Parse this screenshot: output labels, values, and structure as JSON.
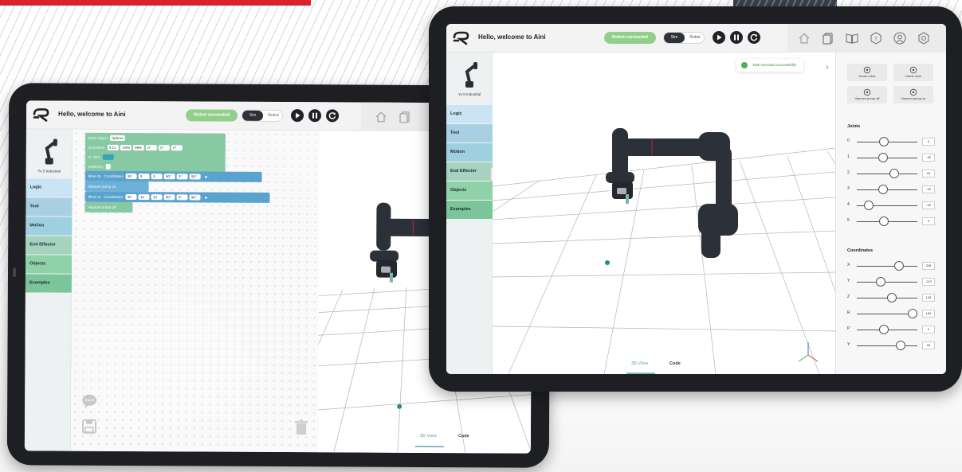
{
  "app": {
    "welcome": "Hello, welcome to Aini",
    "connect_label": "Robot connected",
    "mode_sim": "Sim",
    "mode_robot": "Robot",
    "robot_name": "Yu 5 Industrial",
    "accent_green": "#92cf8a",
    "accent_blue": "#5aa3cf"
  },
  "playback_icons": [
    "play-icon",
    "pause-icon",
    "reset-icon"
  ],
  "nav_icons": [
    "home-icon",
    "files-icon",
    "book-icon",
    "help-icon",
    "user-icon",
    "settings-icon"
  ],
  "categories": [
    {
      "label": "Logic",
      "color": "#c9e4f2"
    },
    {
      "label": "Tool",
      "color": "#a9cfe3"
    },
    {
      "label": "Motion",
      "color": "#9fd0df"
    },
    {
      "label": "End Effector",
      "color": "#a6d3c0"
    },
    {
      "label": "Objects",
      "color": "#8fd2a9"
    },
    {
      "label": "Examples",
      "color": "#7cc59a"
    }
  ],
  "blocks": {
    "place_object": "place object",
    "object_type": "Sphere",
    "at_position": "at position",
    "in_color": "in color",
    "scaled_by": "scaled by",
    "move_to": "Move to",
    "coordinates": "Coordinates",
    "pump_on": "Vacuum pump on",
    "pump_off": "Vacuum pump off",
    "pos_values": [
      "0.1x",
      "-10%",
      "99%",
      "0°",
      "0°",
      "0°"
    ],
    "coords_a": [
      "30",
      "5",
      "3",
      "90°",
      "0°",
      "90°"
    ],
    "coords_b": [
      "30",
      "12",
      "13",
      "90°",
      "0°",
      "90°"
    ]
  },
  "view_tabs": {
    "view3d": "3D View",
    "code": "Code"
  },
  "toast": "Task executed successfully!",
  "control_buttons": [
    "Home robot",
    "Home view",
    "Vacuum pump off",
    "Vacuum pump on"
  ],
  "joints": {
    "title": "Joints",
    "items": [
      {
        "label": "0",
        "value": "0",
        "fraction": 0.45
      },
      {
        "label": "1",
        "value": "-30",
        "fraction": 0.44
      },
      {
        "label": "2",
        "value": "90",
        "fraction": 0.62
      },
      {
        "label": "3",
        "value": "-30",
        "fraction": 0.44
      },
      {
        "label": "4",
        "value": "-90",
        "fraction": 0.2
      },
      {
        "label": "5",
        "value": "0",
        "fraction": 0.45
      }
    ]
  },
  "coordinates": {
    "title": "Coordinates",
    "items": [
      {
        "label": "X",
        "value": "328",
        "fraction": 0.7
      },
      {
        "label": "Y",
        "value": "-213",
        "fraction": 0.4
      },
      {
        "label": "Z",
        "value": "128",
        "fraction": 0.58
      },
      {
        "label": "R",
        "value": "180",
        "fraction": 0.92
      },
      {
        "label": "P",
        "value": "0",
        "fraction": 0.45
      },
      {
        "label": "Y",
        "value": "90",
        "fraction": 0.72
      }
    ]
  }
}
